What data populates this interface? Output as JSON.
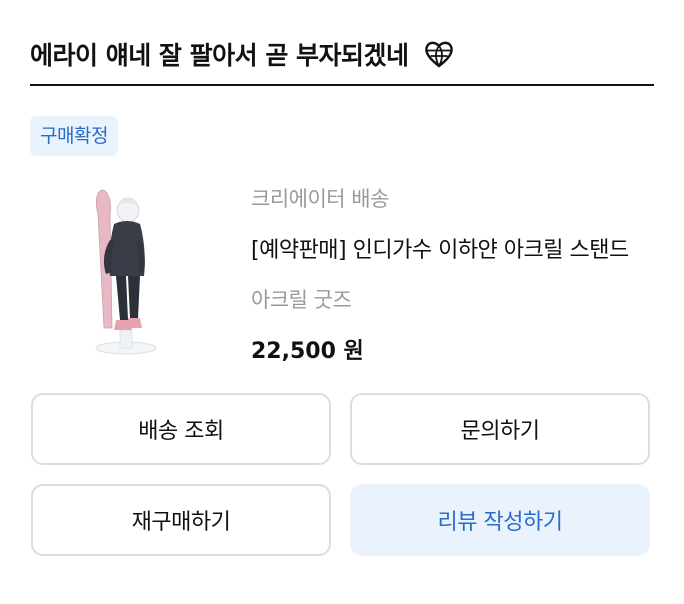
{
  "header": {
    "title": "에라이 얘네 잘 팔아서 곧 부자되겠네",
    "emoji_icon": "heart-globe-icon"
  },
  "order": {
    "status": "구매확정",
    "seller": "크리에이터 배송",
    "product_name": "[예약판매] 인디가수 이하얀 아크릴 스탠드",
    "option": "아크릴 굿즈",
    "price": "22,500 원",
    "image_icon": "acrylic-stand-figure"
  },
  "actions": {
    "track_label": "배송 조회",
    "inquiry_label": "문의하기",
    "rebuy_label": "재구매하기",
    "review_label": "리뷰 작성하기"
  },
  "colors": {
    "accent": "#2a6dc9",
    "badge_bg": "#eaf2fd",
    "border": "#dddddd",
    "muted_text": "#9a9a9a"
  }
}
